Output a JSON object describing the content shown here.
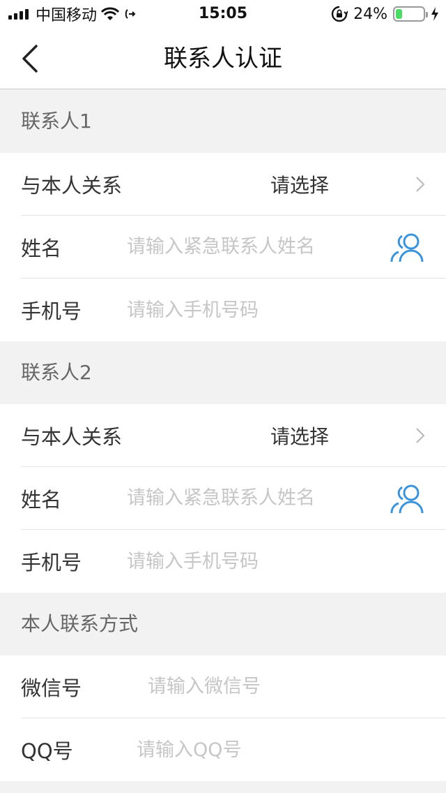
{
  "status_bar": {
    "carrier": "中国移动",
    "time": "15:05",
    "battery_text": "24%",
    "battery_level": 0.24,
    "icons": [
      "signal-icon",
      "wifi-icon",
      "bluetooth-icon",
      "orientation-lock-icon",
      "battery-icon",
      "charging-icon"
    ]
  },
  "nav": {
    "title": "联系人认证",
    "back_icon": "chevron-left-icon"
  },
  "contact1": {
    "header": "联系人1",
    "relation_label": "与本人关系",
    "relation_value": "请选择",
    "name_label": "姓名",
    "name_placeholder": "请输入紧急联系人姓名",
    "phone_label": "手机号",
    "phone_placeholder": "请输入手机号码"
  },
  "contact2": {
    "header": "联系人2",
    "relation_label": "与本人关系",
    "relation_value": "请选择",
    "name_label": "姓名",
    "name_placeholder": "请输入紧急联系人姓名",
    "phone_label": "手机号",
    "phone_placeholder": "请输入手机号码"
  },
  "self_contact": {
    "header": "本人联系方式",
    "wechat_label": "微信号",
    "wechat_placeholder": "请输入微信号",
    "qq_label": "QQ号",
    "qq_placeholder": "请输入QQ号"
  },
  "colors": {
    "accent": "#3a94db",
    "battery_green": "#4cd964",
    "section_bg": "#f2f2f2",
    "placeholder": "#c6c6c6"
  }
}
